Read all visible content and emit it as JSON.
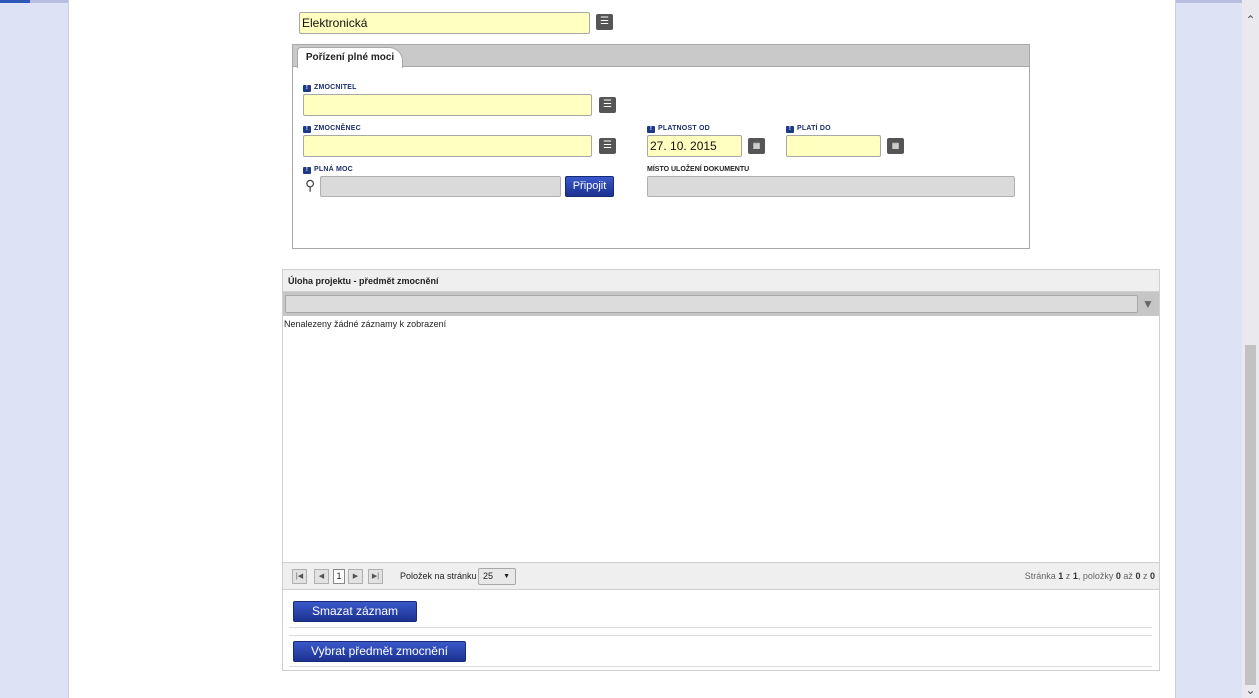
{
  "form": {
    "type_value": "Elektronická",
    "tab_label": "Pořízení plné moci",
    "zmocnitel_label": "ZMOCNITEL",
    "zmocnitel_value": "",
    "zmocnenec_label": "ZMOCNĚNEC",
    "zmocnenec_value": "",
    "platnost_od_label": "PLATNOST OD",
    "platnost_od_value": "27. 10. 2015",
    "plati_do_label": "PLATÍ DO",
    "plati_do_value": "",
    "plna_moc_label": "PLNÁ MOC",
    "pripojit_label": "Připojit",
    "misto_label": "MÍSTO ULOŽENÍ DOKUMENTU",
    "required_marker": "!"
  },
  "grid": {
    "title": "Úloha projektu - předmět zmocnění",
    "empty_message": "Nenalezeny žádné záznamy k zobrazení",
    "pager": {
      "current_page": "1",
      "per_page_label": "Položek na stránku",
      "per_page_value": "25",
      "status_prefix": "Stránka",
      "page": "1",
      "of_word": "z",
      "pages": "1",
      "items_word": ", položky",
      "from": "0",
      "to_word": "až",
      "to": "0",
      "total": "0"
    }
  },
  "actions": {
    "delete_label": "Smazat záznam",
    "select_label": "Vybrat předmět zmocnění"
  },
  "icons": {
    "list": "list-icon",
    "calendar": "calendar-icon",
    "attach": "paperclip-icon",
    "filter": "funnel-icon"
  },
  "colors": {
    "required_field": "#ffffc0",
    "primary_button": "#1d3290",
    "background": "#dde2f5"
  }
}
